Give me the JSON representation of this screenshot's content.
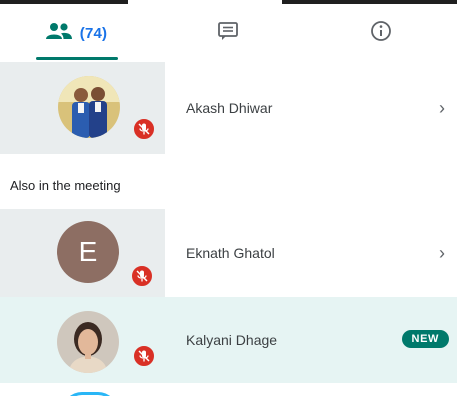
{
  "tabs": {
    "people_count": "(74)",
    "people_icon": "people-icon",
    "chat_icon": "chat-icon",
    "info_icon": "info-icon",
    "accent_color": "#00796b",
    "count_color": "#1a73e8"
  },
  "participants_top": [
    {
      "name": "Akash Dhiwar",
      "muted": true,
      "has_chevron": true
    }
  ],
  "section_label": "Also in the meeting",
  "participants_meeting": [
    {
      "name": "Eknath Ghatol",
      "initial": "E",
      "muted": true,
      "has_chevron": true
    },
    {
      "name": "Kalyani Dhage",
      "muted": true,
      "badge": "NEW"
    }
  ],
  "icons": {
    "mute": "mic-off-icon",
    "chevron": "chevron-right-icon"
  }
}
